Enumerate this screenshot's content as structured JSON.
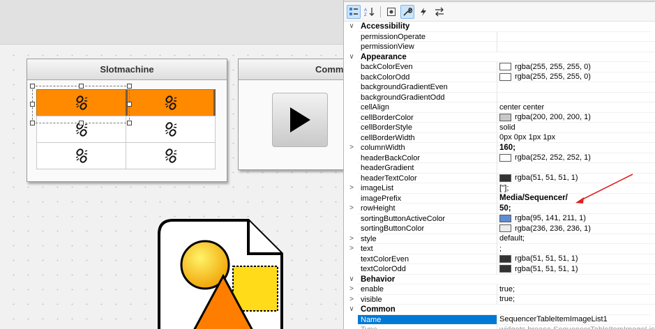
{
  "canvas": {
    "slot_widget": {
      "title": "Slotmachine",
      "cells": [
        {
          "highlighted": true,
          "icon": "broken-link-icon"
        },
        {
          "highlighted": true,
          "icon": "broken-link-icon"
        },
        {
          "highlighted": false,
          "icon": "broken-link-icon"
        },
        {
          "highlighted": false,
          "icon": "broken-link-icon"
        },
        {
          "highlighted": false,
          "icon": "broken-link-icon"
        },
        {
          "highlighted": false,
          "icon": "broken-link-icon"
        }
      ],
      "highlight_color": "#ff8a00"
    },
    "comm_widget": {
      "title": "Comm",
      "button_icon": "play-icon"
    },
    "shapes_icon": "shapes-document-icon"
  },
  "props": {
    "toolbar": [
      "categorized-icon",
      "alphabetical-icon",
      "properties-icon",
      "wrench-icon",
      "events-icon",
      "swap-icon"
    ],
    "rows": [
      {
        "kind": "cat",
        "exp": "∨",
        "name": "Accessibility"
      },
      {
        "name": "permissionOperate",
        "value": ""
      },
      {
        "name": "permissionView",
        "value": ""
      },
      {
        "kind": "cat",
        "exp": "∨",
        "name": "Appearance"
      },
      {
        "name": "backColorEven",
        "value": "rgba(255, 255, 255, 0)",
        "swatch": "#ffffff"
      },
      {
        "name": "backColorOdd",
        "value": "rgba(255, 255, 255, 0)",
        "swatch": "#ffffff"
      },
      {
        "name": "backgroundGradientEven",
        "value": ""
      },
      {
        "name": "backgroundGradientOdd",
        "value": ""
      },
      {
        "name": "cellAlign",
        "value": "center center"
      },
      {
        "name": "cellBorderColor",
        "value": "rgba(200, 200, 200, 1)",
        "swatch": "#c8c8c8"
      },
      {
        "name": "cellBorderStyle",
        "value": "solid"
      },
      {
        "name": "cellBorderWidth",
        "value": "0px 0px 1px 1px"
      },
      {
        "exp": ">",
        "name": "columnWidth",
        "value": "160;",
        "bold": true
      },
      {
        "name": "headerBackColor",
        "value": "rgba(252, 252, 252, 1)",
        "swatch": "#fcfcfc"
      },
      {
        "name": "headerGradient",
        "value": ""
      },
      {
        "name": "headerTextColor",
        "value": "rgba(51, 51, 51, 1)",
        "swatch": "#333333"
      },
      {
        "exp": ">",
        "name": "imageList",
        "value": "[''];"
      },
      {
        "name": "imagePrefix",
        "value": "Media/Sequencer/",
        "bold": true,
        "arrow": true
      },
      {
        "exp": ">",
        "name": "rowHeight",
        "value": "50;",
        "bold": true
      },
      {
        "name": "sortingButtonActiveColor",
        "value": "rgba(95, 141, 211, 1)",
        "swatch": "#5f8dd3"
      },
      {
        "name": "sortingButtonColor",
        "value": "rgba(236, 236, 236, 1)",
        "swatch": "#ececec"
      },
      {
        "exp": ">",
        "name": "style",
        "value": "default;"
      },
      {
        "exp": ">",
        "name": "text",
        "value": ";"
      },
      {
        "name": "textColorEven",
        "value": "rgba(51, 51, 51, 1)",
        "swatch": "#333333"
      },
      {
        "name": "textColorOdd",
        "value": "rgba(51, 51, 51, 1)",
        "swatch": "#333333"
      },
      {
        "kind": "cat",
        "exp": "∨",
        "name": "Behavior"
      },
      {
        "exp": ">",
        "name": "enable",
        "value": "true;"
      },
      {
        "exp": ">",
        "name": "visible",
        "value": "true;"
      },
      {
        "kind": "cat",
        "exp": "∨",
        "name": "Common"
      },
      {
        "name": "Name",
        "value": "SequencerTableItemImageList1",
        "selected": true
      },
      {
        "name": "Type",
        "value": "widgets.brease.SequencerTableItemImageList",
        "dim": true
      }
    ],
    "selection_color": "#0078d7",
    "annotation_arrow_color": "#e02020"
  }
}
